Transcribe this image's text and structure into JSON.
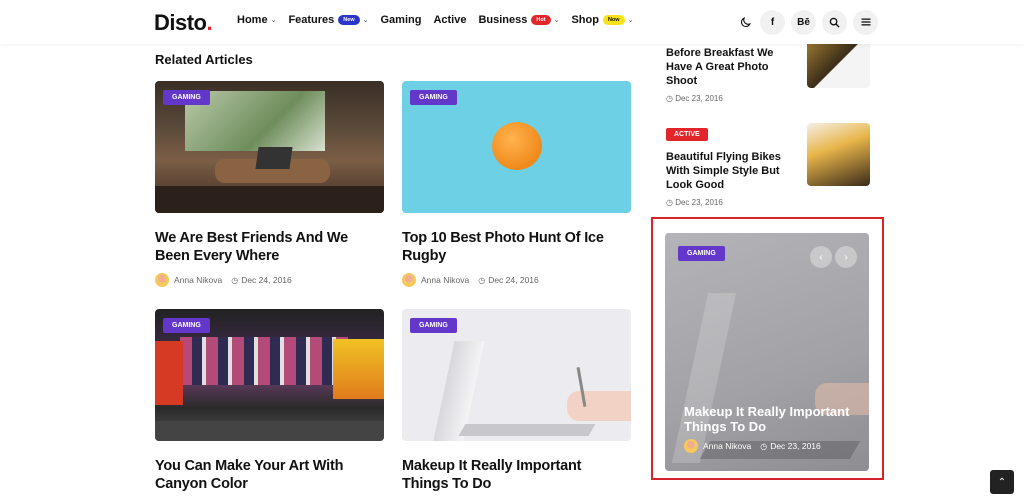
{
  "header": {
    "logo_text": "Disto",
    "logo_dot": ".",
    "nav": [
      {
        "label": "Home",
        "badge": "",
        "has_dropdown": true
      },
      {
        "label": "Features",
        "badge": "New",
        "has_dropdown": true
      },
      {
        "label": "Gaming",
        "badge": "",
        "has_dropdown": false
      },
      {
        "label": "Active",
        "badge": "",
        "has_dropdown": false
      },
      {
        "label": "Business",
        "badge": "Hot",
        "has_dropdown": true
      },
      {
        "label": "Shop",
        "badge": "Now",
        "has_dropdown": true
      }
    ],
    "icons": [
      "moon-icon",
      "facebook-icon",
      "behance-icon",
      "search-icon",
      "menu-icon"
    ],
    "facebook_glyph": "f",
    "behance_glyph": "Bē"
  },
  "main": {
    "section_title": "Related Articles",
    "articles": [
      {
        "category": "GAMING",
        "title": "We Are Best Friends And We Been Every Where",
        "author": "Anna Nikova",
        "date": "Dec 24, 2016"
      },
      {
        "category": "GAMING",
        "title": "Top 10 Best Photo Hunt Of Ice Rugby",
        "author": "Anna Nikova",
        "date": "Dec 24, 2016"
      },
      {
        "category": "GAMING",
        "title": "You Can Make Your Art With Canyon Color",
        "author": "",
        "date": ""
      },
      {
        "category": "GAMING",
        "title": "Makeup It Really Important Things To Do",
        "author": "",
        "date": ""
      }
    ]
  },
  "sidebar": {
    "posts": [
      {
        "badge": "",
        "title": "Before Breakfast We Have A Great Photo Shoot",
        "date": "Dec 23, 2016"
      },
      {
        "badge": "ACTIVE",
        "title": "Beautiful Flying Bikes With Simple Style But Look Good",
        "date": "Dec 23, 2016"
      }
    ],
    "featured": {
      "category": "GAMING",
      "title": "Makeup It Really Important Things To Do",
      "author": "Anna Nikova",
      "date": "Dec 23, 2016",
      "prev_glyph": "‹",
      "next_glyph": "›"
    }
  },
  "back_to_top_glyph": "⌃",
  "colors": {
    "accent_red": "#e3262c",
    "category_purple": "#6237c9",
    "badge_blue": "#2b35c7",
    "badge_yellow": "#f4e21a"
  }
}
